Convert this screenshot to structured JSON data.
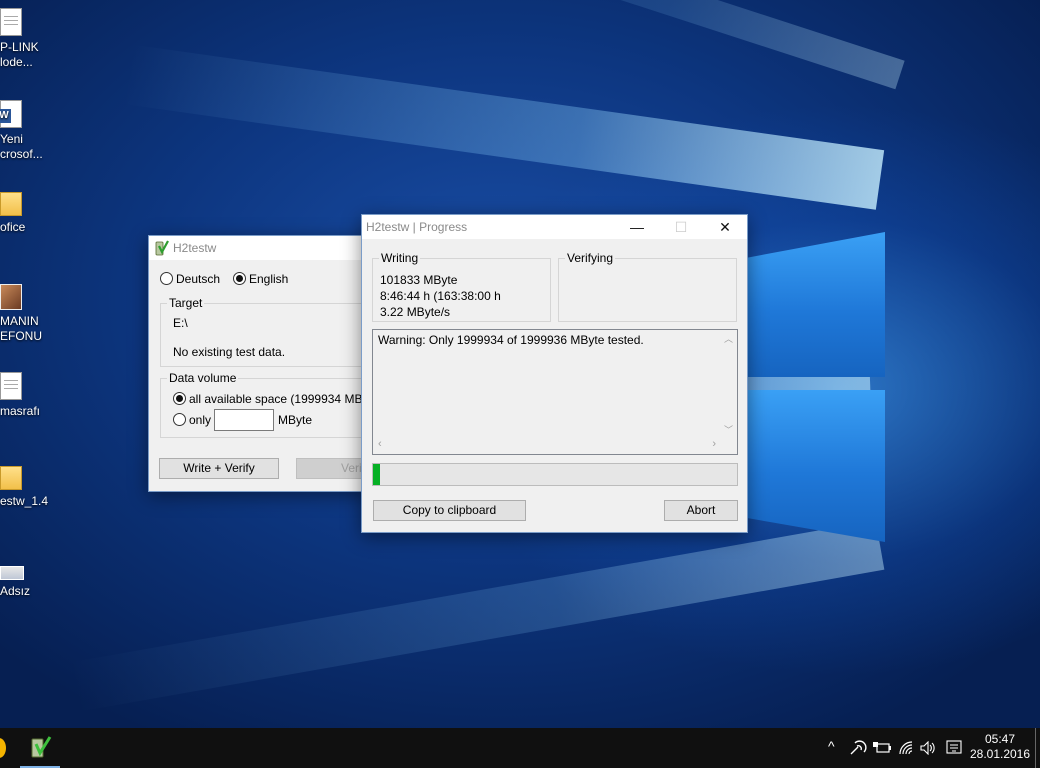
{
  "desktop": {
    "icons": [
      {
        "line1": "P-LINK",
        "line2": "lode...",
        "type": "doc"
      },
      {
        "line1": "Yeni",
        "line2": "crosof...",
        "type": "word"
      },
      {
        "line1": "ofice",
        "line2": "",
        "type": "folder"
      },
      {
        "line1": "MANIN",
        "line2": "EFONU",
        "type": "photo"
      },
      {
        "line1": "masrafı",
        "line2": "",
        "type": "doc"
      },
      {
        "line1": "estw_1.4",
        "line2": "",
        "type": "folder"
      },
      {
        "line1": "Adsız",
        "line2": "",
        "type": "img"
      }
    ]
  },
  "h2testw": {
    "title": "H2testw",
    "lang_deutsch": "Deutsch",
    "lang_english": "English",
    "target_legend": "Target",
    "target_path": "E:\\",
    "target_status": "No existing test data.",
    "volume_legend": "Data volume",
    "all_space": "all available space (1999934 MByte)",
    "only_label": "only",
    "only_value": "",
    "unit": "MByte",
    "write_verify": "Write + Verify",
    "verify": "Verify"
  },
  "progress": {
    "title": "H2testw | Progress",
    "minimize": "—",
    "maximize": "☐",
    "close": "✕",
    "writing_legend": "Writing",
    "writing_mbyte": "101833 MByte",
    "writing_time": "8:46:44 h (163:38:00 h",
    "writing_speed": "3.22 MByte/s",
    "verifying_legend": "Verifying",
    "log_text": "Warning: Only 1999934 of 1999936 MByte tested.",
    "progress_fraction": 0.018,
    "copy_button": "Copy to clipboard",
    "abort_button": "Abort"
  },
  "taskbar": {
    "clock_time": "05:47",
    "clock_date": "28.01.2016",
    "chevron": "^"
  },
  "colors": {
    "progress_fill": "#06b025",
    "taskbar_bg": "#101010",
    "active_indicator": "#7fb2e6"
  }
}
